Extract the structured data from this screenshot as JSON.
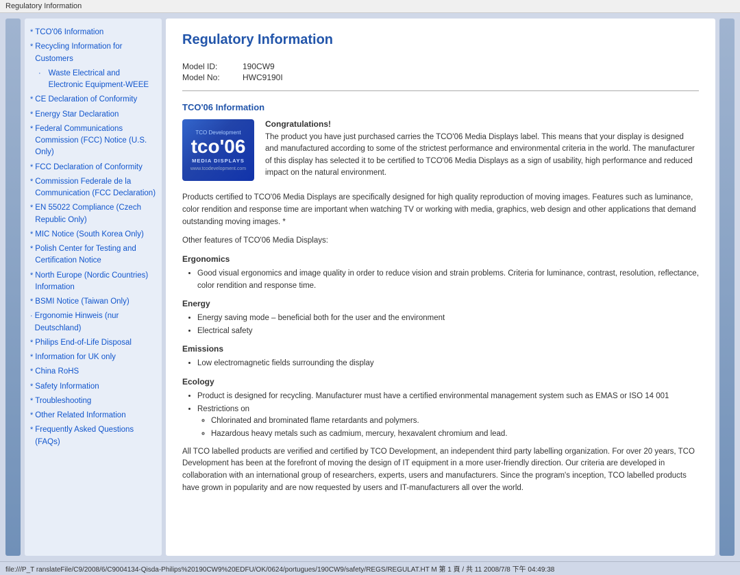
{
  "titleBar": "Regulatory Information",
  "sidebar": {
    "items": [
      {
        "label": "TCO'06 Information",
        "indent": false,
        "bullet": "*"
      },
      {
        "label": "Recycling Information for Customers",
        "indent": false,
        "bullet": "*"
      },
      {
        "label": "Waste Electrical and Electronic Equipment-WEEE",
        "indent": true,
        "bullet": "·"
      },
      {
        "label": "CE Declaration of Conformity",
        "indent": false,
        "bullet": "*"
      },
      {
        "label": "Energy Star Declaration",
        "indent": false,
        "bullet": "*"
      },
      {
        "label": "Federal Communications Commission (FCC) Notice (U.S. Only)",
        "indent": false,
        "bullet": "*"
      },
      {
        "label": "FCC Declaration of Conformity",
        "indent": false,
        "bullet": "*"
      },
      {
        "label": "Commission Federale de la Communication (FCC Declaration)",
        "indent": false,
        "bullet": "*"
      },
      {
        "label": "EN 55022 Compliance (Czech Republic Only)",
        "indent": false,
        "bullet": "*"
      },
      {
        "label": "MIC Notice (South Korea Only)",
        "indent": false,
        "bullet": "*"
      },
      {
        "label": "Polish Center for Testing and Certification Notice",
        "indent": false,
        "bullet": "*"
      },
      {
        "label": "North Europe (Nordic Countries) Information",
        "indent": false,
        "bullet": "*"
      },
      {
        "label": "BSMI Notice (Taiwan Only)",
        "indent": false,
        "bullet": "*"
      },
      {
        "label": "Ergonomie Hinweis (nur Deutschland)",
        "indent": false,
        "bullet": "·"
      },
      {
        "label": "Philips End-of-Life Disposal",
        "indent": false,
        "bullet": "*"
      },
      {
        "label": "Information for UK only",
        "indent": false,
        "bullet": "*"
      },
      {
        "label": "China RoHS",
        "indent": false,
        "bullet": "*"
      },
      {
        "label": "Safety Information",
        "indent": false,
        "bullet": "*"
      },
      {
        "label": "Troubleshooting",
        "indent": false,
        "bullet": "*"
      },
      {
        "label": "Other Related Information",
        "indent": false,
        "bullet": "*"
      },
      {
        "label": "Frequently Asked Questions (FAQs)",
        "indent": false,
        "bullet": "*"
      }
    ]
  },
  "content": {
    "pageTitle": "Regulatory Information",
    "modelIDLabel": "Model ID:",
    "modelIDValue": "190CW9",
    "modelNoLabel": "Model No:",
    "modelNoValue": "HWC9190I",
    "sectionTitle": "TCO'06 Information",
    "tcoLogo": {
      "header": "TCO Development",
      "big": "tco'06",
      "sub": "MEDIA DISPLAYS",
      "url": "www.tcodevelopment.com"
    },
    "congratsTitle": "Congratulations!",
    "congratsText": "The product you have just purchased carries the TCO'06 Media Displays label. This means that your display is designed and manufactured according to some of the strictest performance and environmental criteria in the world. The manufacturer of this display has selected it to be certified to TCO'06 Media Displays as a sign of usability, high performance and reduced impact on the natural environment.",
    "para1": "Products certified to TCO'06 Media Displays are specifically designed for high quality reproduction of moving images. Features such as luminance, color rendition and response time are important when watching TV or working with media, graphics, web design and other applications that demand outstanding moving images. *",
    "para2": "Other features of TCO'06 Media Displays:",
    "subsections": [
      {
        "title": "Ergonomics",
        "items": [
          "Good visual ergonomics and image quality in order to reduce vision and strain problems. Criteria for luminance, contrast, resolution, reflectance, color rendition and response time."
        ]
      },
      {
        "title": "Energy",
        "items": [
          "Energy saving mode – beneficial both for the user and the environment",
          "Electrical safety"
        ]
      },
      {
        "title": "Emissions",
        "items": [
          "Low electromagnetic fields surrounding the display"
        ]
      },
      {
        "title": "Ecology",
        "items": [
          "Product is designed for recycling. Manufacturer must have a certified environmental management system such as EMAS or ISO 14 001",
          "Restrictions on"
        ],
        "subItems": [
          "Chlorinated and brominated flame retardants and polymers.",
          "Hazardous heavy metals such as cadmium, mercury, hexavalent chromium and lead."
        ]
      }
    ],
    "closingPara": "All TCO labelled products are verified and certified by TCO Development, an independent third party labelling organization. For over 20 years, TCO Development has been at the forefront of moving the design of IT equipment in a more user-friendly direction. Our criteria are developed in collaboration with an international group of researchers, experts, users and manufacturers. Since the program's inception, TCO labelled products have grown in popularity and are now requested by users and IT-manufacturers all over the world."
  },
  "statusBar": "file:///P_T ranslateFile/C9/2008/6/C9004134-Qisda-Philips%20190CW9%20EDFU/OK/0624/portugues/190CW9/safety/REGS/REGULAT.HT M 第 1 頁 / 共 11 2008/7/8 下午 04:49:38"
}
